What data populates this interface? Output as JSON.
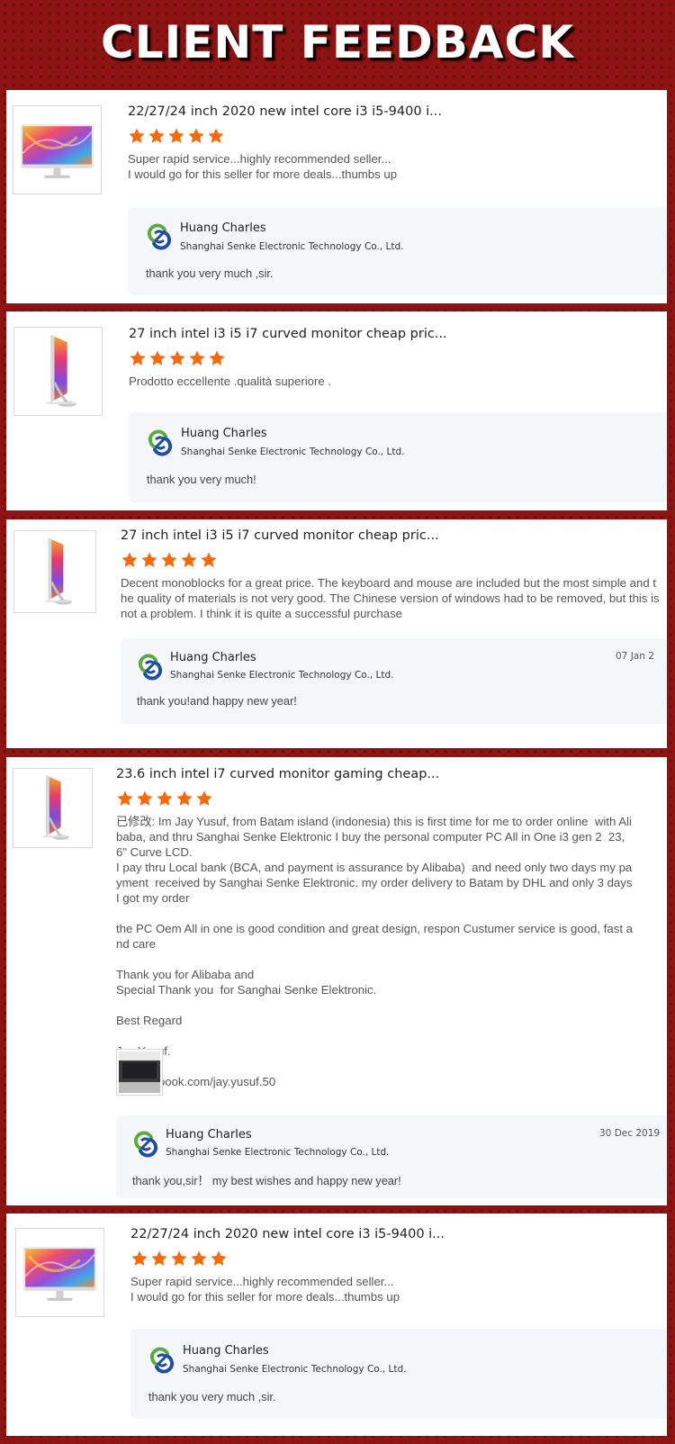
{
  "banner": {
    "title": "CLIENT FEEDBACK"
  },
  "colors": {
    "background": "#8e1414",
    "star": "#f46a0d",
    "reply_bg": "#f5f6f9"
  },
  "reviews": [
    {
      "product_title": "22/27/24 inch 2020 new intel core i3 i5-9400 i...",
      "rating": 5,
      "image_icon": "all-in-one-pc-front-icon",
      "text": "Super rapid service...highly recommended seller...\nI would go for this seller for more deals...thumbs up",
      "reply": {
        "name": "Huang Charles",
        "company": "Shanghai Senke Electronic Technology Co., Ltd.",
        "date": "",
        "text": "thank you very much ,sir."
      }
    },
    {
      "product_title": "27 inch intel i3 i5 i7 curved monitor cheap pric...",
      "rating": 5,
      "image_icon": "all-in-one-pc-side-icon",
      "text": "Prodotto eccellente .qualità superiore .",
      "reply": {
        "name": "Huang Charles",
        "company": "Shanghai Senke Electronic Technology Co., Ltd.",
        "date": "",
        "text": "thank you very much!"
      }
    },
    {
      "product_title": "27 inch intel i3 i5 i7 curved monitor cheap pric...",
      "rating": 5,
      "image_icon": "all-in-one-pc-side-icon",
      "text": "Decent monoblocks for a great price. The keyboard and mouse are included but the most simple and the quality of materials is not very good. The Chinese version of windows had to be removed, but this is not a problem. I think it is quite a successful purchase",
      "reply": {
        "name": "Huang Charles",
        "company": "Shanghai Senke Electronic Technology Co., Ltd.",
        "date": "07 Jan 2",
        "text": "thank you!and happy new year!"
      }
    },
    {
      "product_title": "23.6 inch intel i7 curved monitor gaming cheap...",
      "rating": 5,
      "image_icon": "all-in-one-pc-side-icon",
      "text": "已修改: Im Jay Yusuf, from Batam island (indonesia) this is first time for me to order online  with Alibaba, and thru Sanghai Senke Elektronic I buy the personal computer PC All in One i3 gen 2  23,6\" Curve LCD.\nI pay thru Local bank (BCA, and payment is assurance by Alibaba)  and need only two days my payment  received by Sanghai Senke Elektronic. my order delivery to Batam by DHL and only 3 days I got my order\n\nthe PC Oem All in one is good condition and great design, respon Custumer service is good, fast and care\n\nThank you for Alibaba and\nSpecial Thank you  for Sanghai Senke Elektronic.\n\nBest Regard\n\nJay Yusuf.\n\nfb : facebook.com/jay.yusuf.50",
      "attachment": "customer-photo-thumbnail",
      "reply": {
        "name": "Huang Charles",
        "company": "Shanghai Senke Electronic Technology Co., Ltd.",
        "date": "30 Dec 2019",
        "text": "thank you,sir！ my best wishes and happy new year!"
      }
    },
    {
      "product_title": "22/27/24 inch 2020 new intel core i3 i5-9400 i...",
      "rating": 5,
      "image_icon": "all-in-one-pc-front-icon",
      "text": "Super rapid service...highly recommended seller...\nI would go for this seller for more deals...thumbs up",
      "reply": {
        "name": "Huang Charles",
        "company": "Shanghai Senke Electronic Technology Co., Ltd.",
        "date": "",
        "text": "thank you very much ,sir."
      }
    }
  ]
}
